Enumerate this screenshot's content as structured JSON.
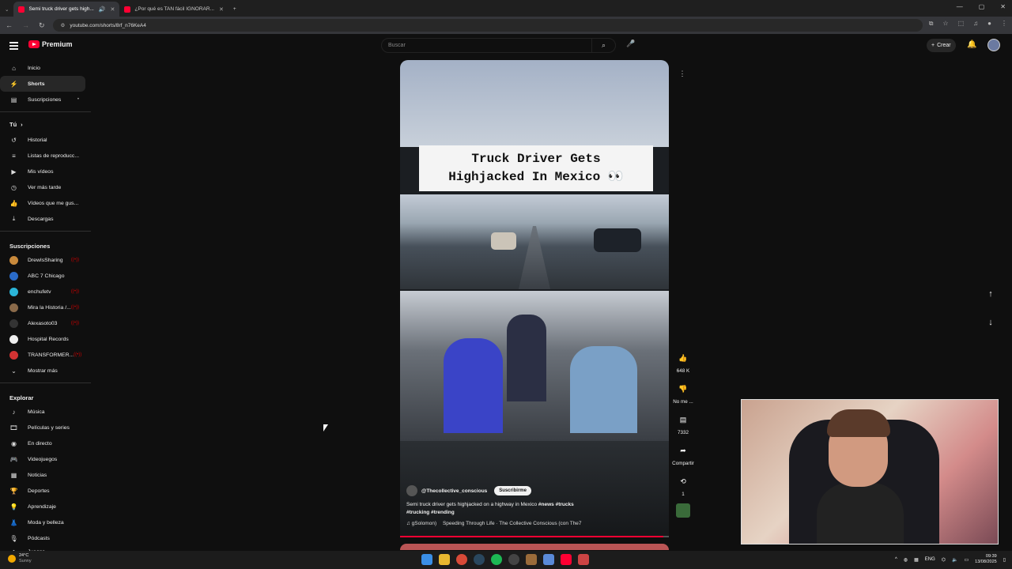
{
  "browser": {
    "tabs": [
      {
        "title": "Semi truck driver gets high..."
      },
      {
        "title": "¿Por qué es TAN fácil IGNORAR..."
      }
    ],
    "new_tab": "+",
    "url": "youtube.com/shorts/8rf_n76KeA4"
  },
  "header": {
    "logo_text": "Premium",
    "search_placeholder": "Buscar",
    "create_label": "Crear"
  },
  "sidebar": {
    "main": [
      {
        "label": "Inicio",
        "icon": "home-icon"
      },
      {
        "label": "Shorts",
        "icon": "shorts-icon"
      },
      {
        "label": "Suscripciones",
        "icon": "subscriptions-icon"
      }
    ],
    "you_title": "Tú",
    "you": [
      {
        "label": "Historial",
        "icon": "history-icon"
      },
      {
        "label": "Listas de reproducc...",
        "icon": "playlist-icon"
      },
      {
        "label": "Mis vídeos",
        "icon": "my-videos-icon"
      },
      {
        "label": "Ver más tarde",
        "icon": "watch-later-icon"
      },
      {
        "label": "Vídeos que me gus...",
        "icon": "like-icon"
      },
      {
        "label": "Descargas",
        "icon": "download-icon"
      }
    ],
    "subs_title": "Suscripciones",
    "subs": [
      {
        "label": "DrewIsSharing",
        "color": "#c98a3c"
      },
      {
        "label": "ABC 7 Chicago",
        "color": "#2a6bc8"
      },
      {
        "label": "enchufetv",
        "color": "#2bb5d8"
      },
      {
        "label": "Mira la Historia /...",
        "color": "#8a6a4a"
      },
      {
        "label": "Alexasoto03",
        "color": "#333333"
      },
      {
        "label": "Hospital Records",
        "color": "#eeeeee"
      },
      {
        "label": "TRANSFORMER...",
        "color": "#d33333"
      }
    ],
    "show_more": "Mostrar más",
    "explore_title": "Explorar",
    "explore": [
      {
        "label": "Música",
        "icon": "music-icon"
      },
      {
        "label": "Películas y series",
        "icon": "movies-icon"
      },
      {
        "label": "En directo",
        "icon": "live-icon"
      },
      {
        "label": "Videojuegos",
        "icon": "gaming-icon"
      },
      {
        "label": "Noticias",
        "icon": "news-icon"
      },
      {
        "label": "Deportes",
        "icon": "sports-icon"
      },
      {
        "label": "Aprendizaje",
        "icon": "learning-icon"
      },
      {
        "label": "Moda y belleza",
        "icon": "fashion-icon"
      },
      {
        "label": "Pódcasts",
        "icon": "podcasts-icon"
      },
      {
        "label": "Juegos",
        "icon": "games-icon"
      }
    ]
  },
  "short": {
    "overlay_title_line1": "Truck Driver Gets",
    "overlay_title_line2": "Highjacked In Mexico 👀",
    "channel": "@Thecollective_conscious",
    "subscribe_label": "Suscribirme",
    "description": "Semi truck driver gets highjacked on a highway in Mexico",
    "hashtags_line1": "#news #trucks",
    "hashtags_line2": "#trucking #trending",
    "music_prefix": "♫ gSolomon)",
    "music": "Speeding Through Life · The Collective Conscious (con The7",
    "progress": 0.98
  },
  "actions": {
    "likes": "648 K",
    "dislike_label": "No me ...",
    "comments": "7332",
    "share_label": "Compartir",
    "remix_count": "1"
  },
  "taskbar": {
    "temp": "24°C",
    "weather": "Sunny",
    "lang": "ENG",
    "time": "09:39",
    "date": "13/08/2025"
  }
}
